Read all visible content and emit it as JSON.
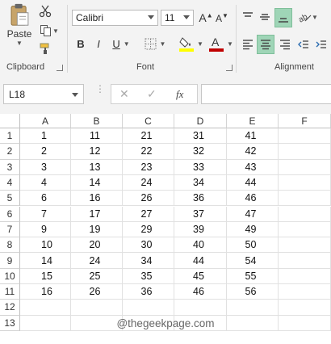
{
  "ribbon": {
    "clipboard": {
      "paste_label": "Paste",
      "group_label": "Clipboard"
    },
    "font": {
      "font_name": "Calibri",
      "font_size": "11",
      "bold": "B",
      "italic": "I",
      "underline": "U",
      "group_label": "Font",
      "font_color": "#c00000",
      "highlight_color": "#ffff00"
    },
    "alignment": {
      "group_label": "Alignment",
      "active_color": "#9fd5b7"
    }
  },
  "formula_bar": {
    "name_box": "L18",
    "fx_label": "fx"
  },
  "sheet": {
    "columns": [
      "A",
      "B",
      "C",
      "D",
      "E",
      "F"
    ],
    "rows": [
      "1",
      "2",
      "3",
      "4",
      "5",
      "6",
      "7",
      "8",
      "9",
      "10",
      "11",
      "12",
      "13"
    ],
    "data": [
      [
        "1",
        "11",
        "21",
        "31",
        "41"
      ],
      [
        "2",
        "12",
        "22",
        "32",
        "42"
      ],
      [
        "3",
        "13",
        "23",
        "33",
        "43"
      ],
      [
        "4",
        "14",
        "24",
        "34",
        "44"
      ],
      [
        "6",
        "16",
        "26",
        "36",
        "46"
      ],
      [
        "7",
        "17",
        "27",
        "37",
        "47"
      ],
      [
        "9",
        "19",
        "29",
        "39",
        "49"
      ],
      [
        "10",
        "20",
        "30",
        "40",
        "50"
      ],
      [
        "14",
        "24",
        "34",
        "44",
        "54"
      ],
      [
        "15",
        "25",
        "35",
        "45",
        "55"
      ],
      [
        "16",
        "26",
        "36",
        "46",
        "56"
      ]
    ]
  },
  "watermark": "@thegeekpage.com"
}
